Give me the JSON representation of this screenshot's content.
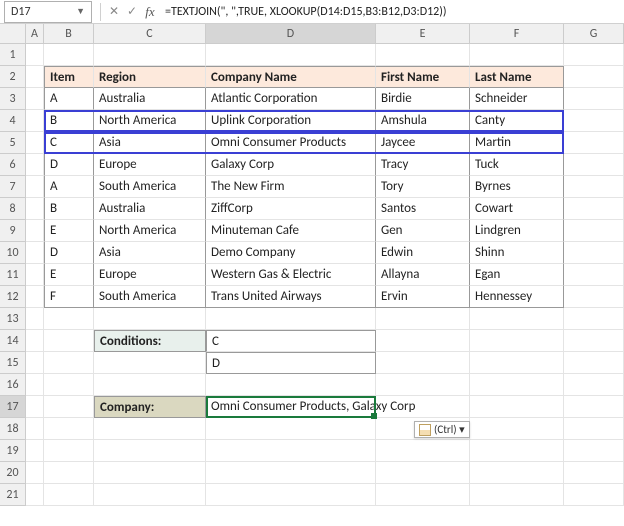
{
  "name_box": "D17",
  "formula": "=TEXTJOIN(\", \",TRUE, XLOOKUP(D14:D15,B3:B12,D3:D12))",
  "col_letters": [
    "A",
    "B",
    "C",
    "D",
    "E",
    "F",
    "G"
  ],
  "row_nums": [
    "1",
    "2",
    "3",
    "4",
    "5",
    "6",
    "7",
    "8",
    "9",
    "10",
    "11",
    "12",
    "13",
    "14",
    "15",
    "16",
    "17",
    "18",
    "19",
    "20",
    "21"
  ],
  "headers": {
    "item": "Item",
    "region": "Region",
    "company": "Company Name",
    "first": "First Name",
    "last": "Last Name"
  },
  "table": [
    {
      "item": "A",
      "region": "Australia",
      "company": "Atlantic Corporation",
      "first": "Birdie",
      "last": "Schneider"
    },
    {
      "item": "B",
      "region": "North America",
      "company": "Uplink Corporation",
      "first": "Amshula",
      "last": "Canty"
    },
    {
      "item": "C",
      "region": "Asia",
      "company": "Omni Consumer Products",
      "first": "Jaycee",
      "last": "Martin"
    },
    {
      "item": "D",
      "region": "Europe",
      "company": "Galaxy Corp",
      "first": "Tracy",
      "last": "Tuck"
    },
    {
      "item": "A",
      "region": "South America",
      "company": "The New Firm",
      "first": "Tory",
      "last": "Byrnes"
    },
    {
      "item": "B",
      "region": "Australia",
      "company": "ZiffCorp",
      "first": "Santos",
      "last": "Cowart"
    },
    {
      "item": "E",
      "region": "North America",
      "company": "Minuteman Cafe",
      "first": "Gen",
      "last": "Lindgren"
    },
    {
      "item": "D",
      "region": "Asia",
      "company": "Demo Company",
      "first": "Edwin",
      "last": "Shinn"
    },
    {
      "item": "E",
      "region": "Europe",
      "company": "Western Gas & Electric",
      "first": "Allayna",
      "last": "Egan"
    },
    {
      "item": "F",
      "region": "South America",
      "company": "Trans United Airways",
      "first": "Ervin",
      "last": "Hennessey"
    }
  ],
  "conditions_label": "Conditions:",
  "conditions": [
    "C",
    "D"
  ],
  "company_label": "Company:",
  "company_result": "Omni Consumer Products, Galaxy Corp",
  "paste_options": "(Ctrl) ▾"
}
